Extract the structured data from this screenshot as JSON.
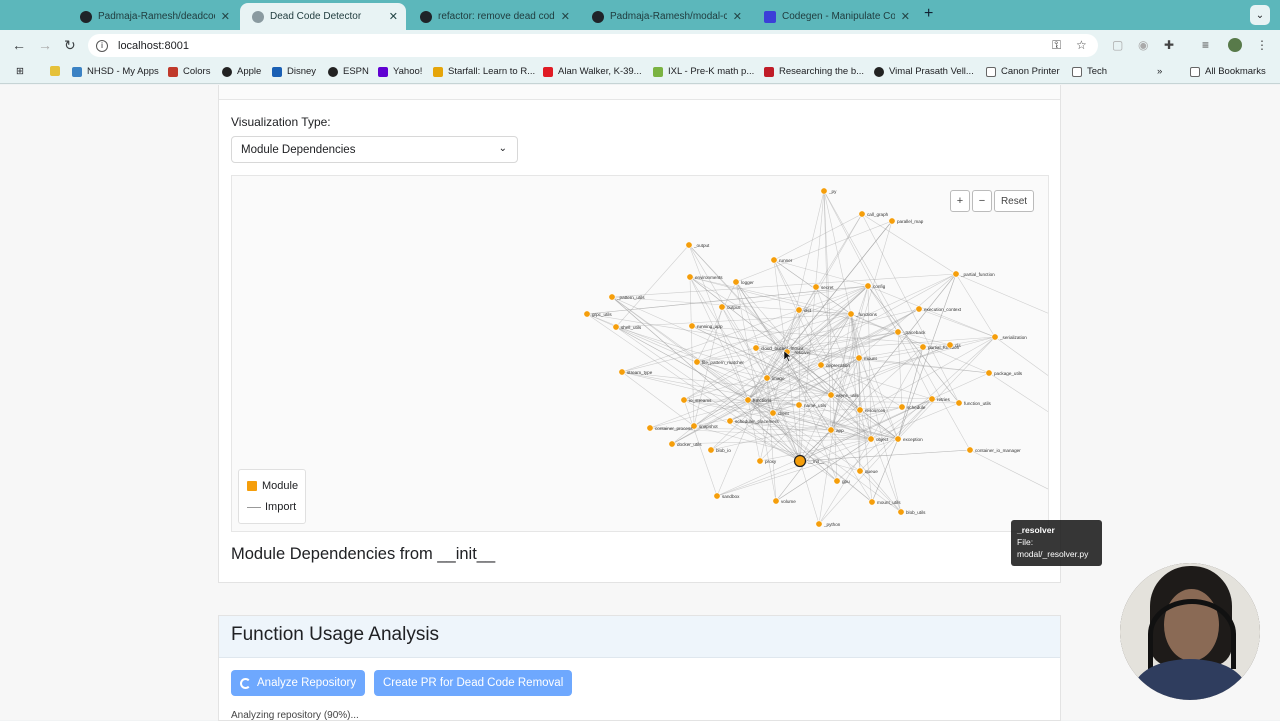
{
  "browser": {
    "tabs": [
      {
        "title": "Padmaja-Ramesh/deadcode_",
        "icon": "github-icon",
        "active": false
      },
      {
        "title": "Dead Code Detector",
        "icon": "globe-icon",
        "active": true
      },
      {
        "title": "refactor: remove dead code",
        "icon": "github-icon",
        "active": false
      },
      {
        "title": "Padmaja-Ramesh/modal-clie",
        "icon": "github-icon",
        "active": false
      },
      {
        "title": "Codegen - Manipulate Code",
        "icon": "codegen-icon",
        "active": false
      }
    ],
    "address": "localhost:8001",
    "bookmarks": [
      {
        "label": "NHSD - My Apps",
        "color": "#3b82c4"
      },
      {
        "label": "Colors",
        "color": "#c0392b"
      },
      {
        "label": "Apple",
        "color": "#222222"
      },
      {
        "label": "Disney",
        "color": "#1a5fb4"
      },
      {
        "label": "ESPN",
        "color": "#222222"
      },
      {
        "label": "Yahoo!",
        "color": "#6001d2"
      },
      {
        "label": "Starfall: Learn to R...",
        "color": "#e5a50a"
      },
      {
        "label": "Alan Walker, K-39...",
        "color": "#e01b24"
      },
      {
        "label": "IXL - Pre-K math p...",
        "color": "#7bb342"
      },
      {
        "label": "Researching the b...",
        "color": "#c01c28"
      },
      {
        "label": "Vimal Prasath Vell...",
        "color": "#222222"
      },
      {
        "label": "Canon Printer",
        "color": "#777777"
      },
      {
        "label": "Tech",
        "color": "#777777"
      }
    ],
    "all_bookmarks": "All Bookmarks"
  },
  "visualization": {
    "label": "Visualization Type:",
    "selected": "Module Dependencies",
    "zoom_in": "+",
    "zoom_out": "−",
    "reset": "Reset",
    "legend_module": "Module",
    "legend_import": "Import",
    "title": "Module Dependencies from __init__",
    "node_color": "#f59e0b"
  },
  "graph": {
    "nodes": [
      {
        "id": "_py",
        "label": "_py"
      },
      {
        "id": "call_graph",
        "label": "call_graph"
      },
      {
        "id": "parallel_map",
        "label": "parallel_map"
      },
      {
        "id": "_output",
        "label": "_output"
      },
      {
        "id": "runner",
        "label": "runner"
      },
      {
        "id": "environments",
        "label": "environments"
      },
      {
        "id": "logger",
        "label": "logger"
      },
      {
        "id": "secret",
        "label": "secret"
      },
      {
        "id": "config",
        "label": "config"
      },
      {
        "id": "partial_function",
        "label": "_partial_function"
      },
      {
        "id": "pattern_utils",
        "label": "_pattern_utils"
      },
      {
        "id": "output",
        "label": "output"
      },
      {
        "id": "dict",
        "label": "dict"
      },
      {
        "id": "functions",
        "label": "_functions"
      },
      {
        "id": "execution_context",
        "label": "execution_context"
      },
      {
        "id": "grpc_utils",
        "label": "grpc_utils"
      },
      {
        "id": "shell_utils",
        "label": "shell_utils"
      },
      {
        "id": "running_app",
        "label": "running_app"
      },
      {
        "id": "traceback",
        "label": "_traceback"
      },
      {
        "id": "serialization",
        "label": "_serialization"
      },
      {
        "id": "cloud_bucket_mount",
        "label": "cloud_bucket_mount"
      },
      {
        "id": "resolver",
        "label": "_resolver"
      },
      {
        "id": "partial_function2",
        "label": "partial_function"
      },
      {
        "id": "cls",
        "label": "cls"
      },
      {
        "id": "mount",
        "label": "mount"
      },
      {
        "id": "file_pattern_matcher",
        "label": "file_pattern_matcher"
      },
      {
        "id": "deprecation",
        "label": "deprecation"
      },
      {
        "id": "stream_type",
        "label": "stream_type"
      },
      {
        "id": "image",
        "label": "image"
      },
      {
        "id": "package_utils",
        "label": "package_utils"
      },
      {
        "id": "async_utils",
        "label": "async_utils"
      },
      {
        "id": "io_streams",
        "label": "io_streams"
      },
      {
        "id": "functions2",
        "label": "functions"
      },
      {
        "id": "retries",
        "label": "retries"
      },
      {
        "id": "function_utils",
        "label": "function_utils"
      },
      {
        "id": "name_utils",
        "label": "name_utils"
      },
      {
        "id": "schedule",
        "label": "schedule"
      },
      {
        "id": "client",
        "label": "client"
      },
      {
        "id": "resources",
        "label": "resources"
      },
      {
        "id": "scheduler_placement",
        "label": "scheduler_placement"
      },
      {
        "id": "snapshot",
        "label": "snapshot"
      },
      {
        "id": "container_process",
        "label": "container_process"
      },
      {
        "id": "app",
        "label": "app"
      },
      {
        "id": "object",
        "label": "object"
      },
      {
        "id": "exception",
        "label": "exception"
      },
      {
        "id": "docker_utils",
        "label": "docker_utils"
      },
      {
        "id": "blob_io",
        "label": "blob_io"
      },
      {
        "id": "container_io_manager",
        "label": "container_io_manager"
      },
      {
        "id": "proxy",
        "label": "proxy"
      },
      {
        "id": "init",
        "label": "__init__"
      },
      {
        "id": "queue",
        "label": "queue"
      },
      {
        "id": "gpu",
        "label": "gpu"
      },
      {
        "id": "sandbox",
        "label": "sandbox"
      },
      {
        "id": "volume",
        "label": "volume"
      },
      {
        "id": "mount_utils",
        "label": "mount_utils"
      },
      {
        "id": "blob_utils",
        "label": "blob_utils"
      },
      {
        "id": "python",
        "label": "_python"
      }
    ]
  },
  "function_usage": {
    "title": "Function Usage Analysis",
    "analyze_button": "Analyze Repository",
    "pr_button": "Create PR for Dead Code Removal",
    "progress_text": "Analyzing repository (90%)...",
    "progress": 0.9
  },
  "tooltip": {
    "name": "_resolver",
    "file_label": "File:",
    "file_path": "modal/_resolver.py"
  }
}
